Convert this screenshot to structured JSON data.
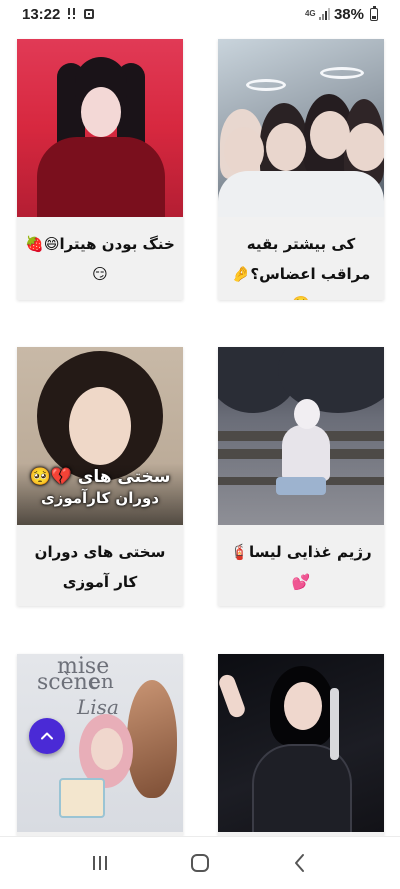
{
  "status_bar": {
    "time": "13:22",
    "network_type": "4G",
    "battery_percent": "38%",
    "icons": [
      "voicemail-alert-icon",
      "notification-box-icon",
      "signal-icon",
      "battery-icon"
    ]
  },
  "posts": [
    {
      "caption": "کی بیشتر بقیه مراقب اعضاس؟🤌🥺",
      "image": "group-selfie-with-halos"
    },
    {
      "caption": "خنگ بودن هیترا😄🍓 😏",
      "image": "girl-red-background"
    },
    {
      "caption": "رژیم غذایی لیسا🧯💕",
      "image": "girl-sitting-on-bench"
    },
    {
      "caption": "سختی های دوران کار آموزی",
      "image": "girl-curly-hair",
      "overlay_lines": [
        "سختی های 💔🥺",
        "دوران کارآموزی"
      ]
    },
    {
      "caption": "",
      "image": "girl-stage-performance-mic"
    },
    {
      "caption": "",
      "image": "girl-birthday-balloons",
      "overlay_lines": [
        "mise",
        "en",
        "scène",
        "Lisa"
      ]
    }
  ],
  "fab": {
    "icon": "chevron-up-icon",
    "color": "#4a2ad6"
  },
  "nav_bar": {
    "buttons": [
      "recent-apps-icon",
      "home-icon",
      "back-icon"
    ]
  }
}
